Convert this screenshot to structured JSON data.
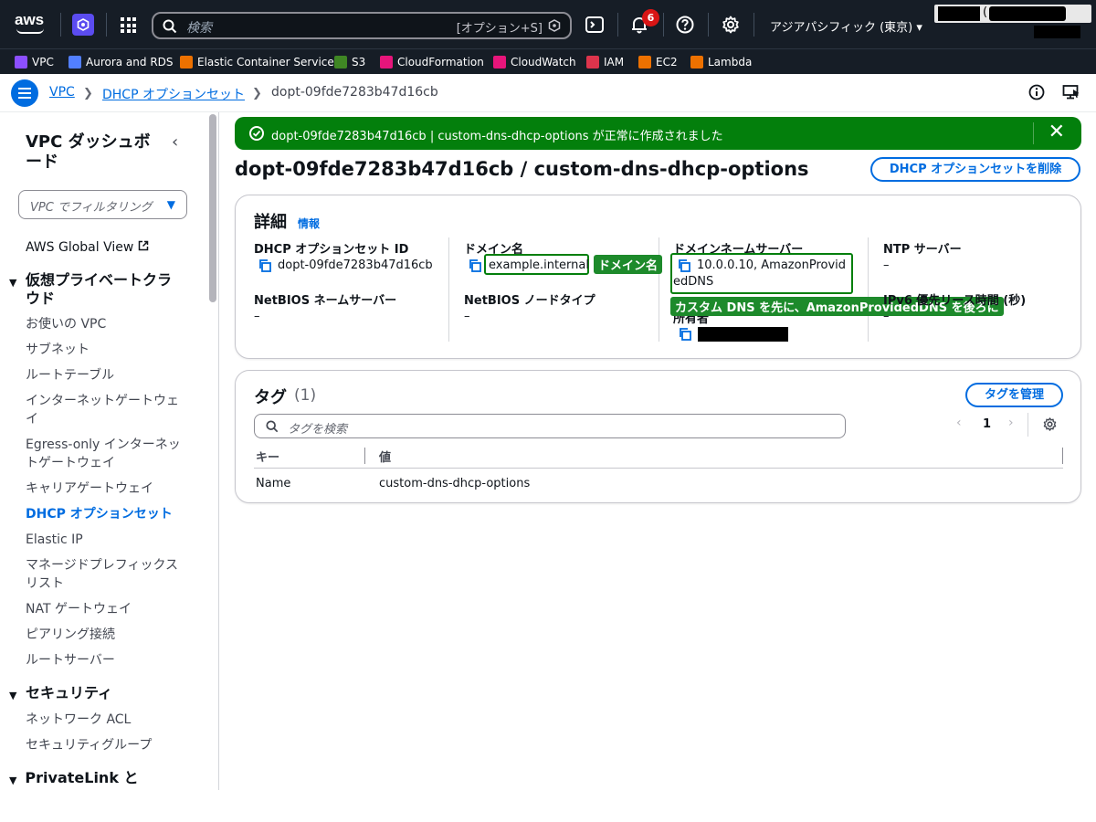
{
  "topnav": {
    "logo": "aws",
    "search_placeholder": "検索",
    "search_shortcut": "[オプション+S]",
    "notification_count": "6",
    "region": "アジアパシフィック (東京)",
    "account_paren": "("
  },
  "favorites": [
    {
      "label": "VPC",
      "color": "#8c4fff"
    },
    {
      "label": "Aurora and RDS",
      "color": "#527fff"
    },
    {
      "label": "Elastic Container Service",
      "color": "#ed7100"
    },
    {
      "label": "S3",
      "color": "#3f8624"
    },
    {
      "label": "CloudFormation",
      "color": "#e7157b"
    },
    {
      "label": "CloudWatch",
      "color": "#e7157b"
    },
    {
      "label": "IAM",
      "color": "#dd344c"
    },
    {
      "label": "EC2",
      "color": "#ed7100"
    },
    {
      "label": "Lambda",
      "color": "#ed7100"
    }
  ],
  "breadcrumb": {
    "items": [
      "VPC",
      "DHCP オプションセット",
      "dopt-09fde7283b47d16cb"
    ]
  },
  "sidebar": {
    "title": "VPC ダッシュボード",
    "filter_placeholder": "VPC でフィルタリング",
    "global_view": "AWS Global View",
    "sections": [
      {
        "title": "仮想プライベートクラウド",
        "items": [
          "お使いの VPC",
          "サブネット",
          "ルートテーブル",
          "インターネットゲートウェイ",
          "Egress-only インターネットゲートウェイ",
          "キャリアゲートウェイ",
          "DHCP オプションセット",
          "Elastic IP",
          "マネージドプレフィックスリスト",
          "NAT ゲートウェイ",
          "ピアリング接続",
          "ルートサーバー"
        ]
      },
      {
        "title": "セキュリティ",
        "items": [
          "ネットワーク ACL",
          "セキュリティグループ"
        ]
      },
      {
        "title": "PrivateLink と Lattice",
        "items": []
      }
    ]
  },
  "flash": {
    "message": "dopt-09fde7283b47d16cb | custom-dns-dhcp-options が正常に作成されました"
  },
  "page": {
    "title": "dopt-09fde7283b47d16cb / custom-dns-dhcp-options",
    "delete_button": "DHCP オプションセットを削除"
  },
  "details": {
    "heading": "詳細",
    "info": "情報",
    "id_label": "DHCP オプションセット ID",
    "id_value": "dopt-09fde7283b47d16cb",
    "domain_label": "ドメイン名",
    "domain_value": "example.internal",
    "dns_label": "ドメインネームサーバー",
    "dns_value": "10.0.0.10, AmazonProvidedDNS",
    "ntp_label": "NTP サーバー",
    "ntp_value": "–",
    "netbios_ns_label": "NetBIOS ネームサーバー",
    "netbios_ns_value": "–",
    "netbios_type_label": "NetBIOS ノードタイプ",
    "netbios_type_value": "–",
    "ipv6_label": "IPv6 優先リース時間 (秒)",
    "ipv6_value": "–",
    "owner_label": "所有者"
  },
  "annotations": {
    "domain_tag": "ドメイン名",
    "dns_tag": "カスタム DNS を先に、AmazonProvidedDNS を後ろに"
  },
  "tags": {
    "heading": "タグ",
    "count": "(1)",
    "manage_button": "タグを管理",
    "search_placeholder": "タグを検索",
    "page": "1",
    "columns": [
      "キー",
      "値"
    ],
    "rows": [
      {
        "key": "Name",
        "value": "custom-dns-dhcp-options"
      }
    ]
  }
}
